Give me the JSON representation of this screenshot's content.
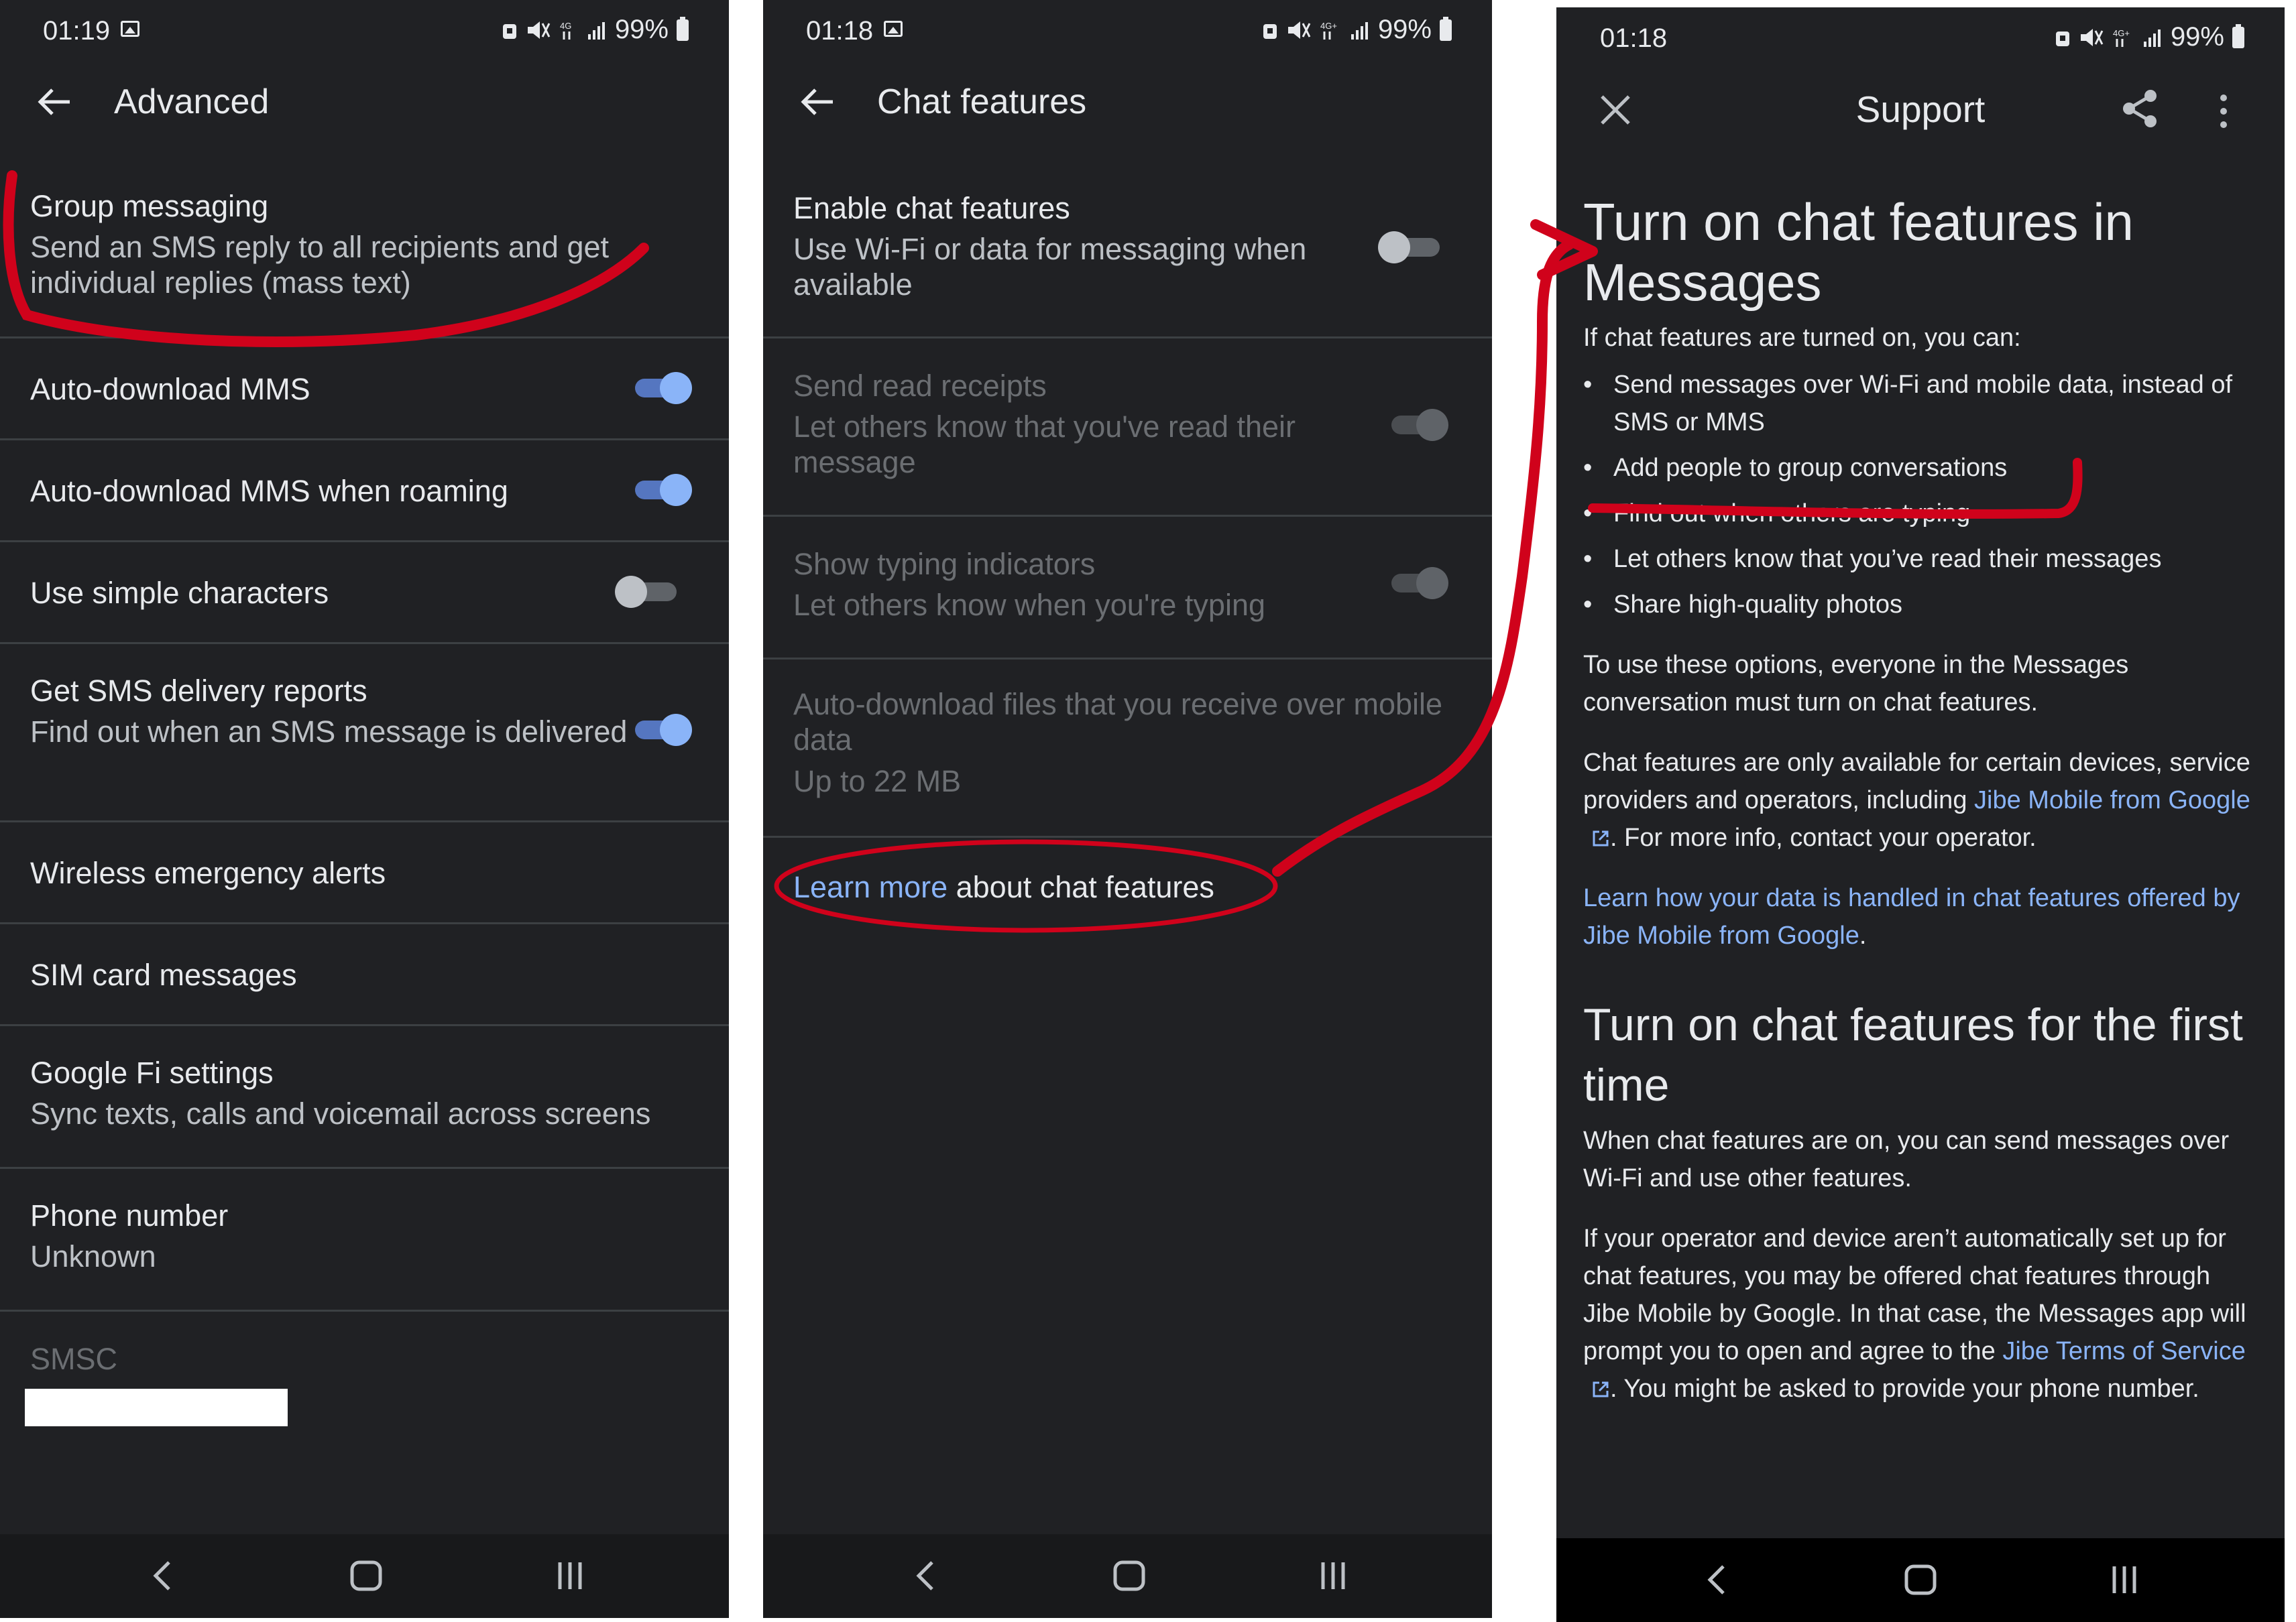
{
  "status_left": {
    "time": "01:19",
    "battery": "99%",
    "network": "4G"
  },
  "status_mid": {
    "time": "01:18",
    "battery": "99%",
    "network": "4G+"
  },
  "status_right": {
    "time": "01:18",
    "battery": "99%",
    "network": "4G+"
  },
  "advanced": {
    "title": "Advanced",
    "items": [
      {
        "title": "Group messaging",
        "subtitle": "Send an SMS reply to all recipients and get individual replies (mass text)"
      },
      {
        "title": "Auto-download MMS",
        "toggle": "on"
      },
      {
        "title": "Auto-download MMS when roaming",
        "toggle": "on"
      },
      {
        "title": "Use simple characters",
        "toggle": "off"
      },
      {
        "title": "Get SMS delivery reports",
        "subtitle": "Find out when an SMS message is delivered",
        "toggle": "on"
      },
      {
        "title": "Wireless emergency alerts"
      },
      {
        "title": "SIM card messages"
      },
      {
        "title": "Google Fi settings",
        "subtitle": "Sync texts, calls and voicemail across screens"
      },
      {
        "title": "Phone number",
        "subtitle": "Unknown"
      },
      {
        "title": "SMSC"
      }
    ]
  },
  "chat": {
    "title": "Chat features",
    "items": [
      {
        "title": "Enable chat features",
        "subtitle": "Use Wi-Fi or data for messaging when available",
        "toggle": "off"
      },
      {
        "title": "Send read receipts",
        "subtitle": "Let others know that you've read their message",
        "toggle": "disabled"
      },
      {
        "title": "Show typing indicators",
        "subtitle": "Let others know when you're typing",
        "toggle": "disabled"
      },
      {
        "title": "Auto-download files that you receive over mobile data",
        "subtitle": "Up to 22 MB"
      }
    ],
    "learn_link": "Learn more",
    "learn_rest": " about chat features"
  },
  "support": {
    "title": "Support",
    "h1": "Turn on chat features in Messages",
    "intro": "If chat features are turned on, you can:",
    "bullets": [
      "Send messages over Wi-Fi and mobile data, instead of SMS or MMS",
      "Add people to group conversations",
      "Find out when others are typing",
      "Let others know that you’ve read their messages",
      "Share high-quality photos"
    ],
    "p1": "To use these options, everyone in the Messages conversation must turn on chat features.",
    "p2_a": "Chat features are only available for certain devices, service providers and operators, including ",
    "p2_link": "Jibe Mobile from Google",
    "p2_b": ". For more info, contact your operator.",
    "p3_link": "Learn how your data is handled in chat features offered by Jibe Mobile from Google",
    "p3_end": ".",
    "h2": "Turn on chat features for the first time",
    "p4": "When chat features are on, you can send messages over Wi-Fi and use other features.",
    "p5_a": "If your operator and device aren’t automatically set up for chat features, you may be offered chat features through Jibe Mobile by Google. In that case, the Messages app will prompt you to open and agree to the ",
    "p5_link": "Jibe Terms of Service",
    "p5_b": ". You might be asked to provide your phone number."
  },
  "colors": {
    "background": "#202124",
    "accent": "#8ab4f8",
    "annotation": "#d0021b"
  }
}
